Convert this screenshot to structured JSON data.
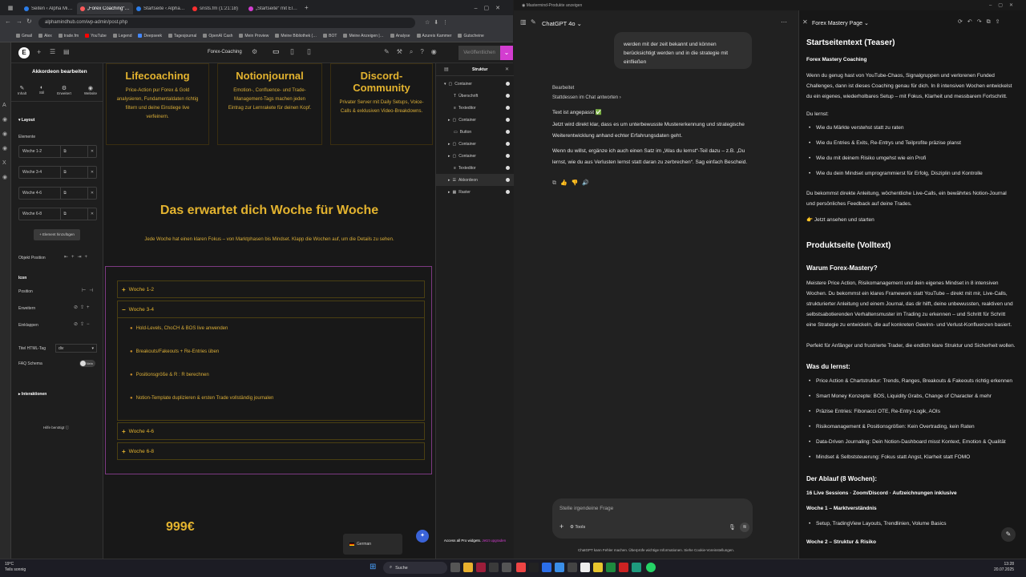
{
  "browser": {
    "tabs": [
      {
        "label": "Seiten ‹ Alpha Mind H…",
        "active": false
      },
      {
        "label": "„Forex Coaching“ mit El…",
        "active": true
      },
      {
        "label": "Startseite ‹ Alpha Mind H…",
        "active": false
      },
      {
        "label": "snsts.fm (1:21:18)",
        "active": false
      },
      {
        "label": "„Startseite“ mit Element…",
        "active": false
      }
    ],
    "url": "alphamindhub.com/wp-admin/post.php",
    "bookmarks": [
      "Gmail",
      "Alex",
      "trade.fm",
      "YouTube",
      "Legend",
      "Deepseek",
      "Tagesjournal",
      "OpenAI Cash",
      "Mein Proview",
      "Meine Bibliothek (…",
      "BOT",
      "Meine Anzeigen |…",
      "Analyse",
      "Azureis Kammer",
      "Gutscheine"
    ]
  },
  "editor": {
    "logo": "E",
    "page_selector": "Forex-Coaching",
    "publish_label": "Veröffentlichen",
    "left_panel": {
      "title": "Akkordeon bearbeiten",
      "tabs": [
        "Inhalt",
        "Stil",
        "Erweitert",
        "Website"
      ],
      "layout_section": "Layout",
      "elements_label": "Elemente",
      "items": [
        "Woche 1-2",
        "Woche 3-4",
        "Woche 4-6",
        "Woche 6-8"
      ],
      "add_button": "Element hinzufügen",
      "object_position": "Objekt Position",
      "icon_section": "Icon",
      "position_label": "Position",
      "expand_label": "Erweitern",
      "collapse_label": "Einklappen",
      "title_html_tag": "Titel HTML-Tag",
      "title_html_value": "div",
      "faq_schema": "FAQ Schema",
      "toggle_value": "Nein",
      "interactions": "Interaktionen",
      "help": "Hilfe benötigt"
    },
    "canvas": {
      "services": [
        {
          "title": "Lifecoaching",
          "text": "Price-Action pur Forex & Gold analysieren, Fundamentaldaten richtig filtern und deine Einstiege live verfeinern."
        },
        {
          "title": "Notionjournal",
          "text": "Emotion-, Confluence- und Trade-Management-Tags machen jeden Eintrag zur Lernrakete für deinen Kopf."
        },
        {
          "title": "Discord-Community",
          "text": "Privater Server mit Daily Setups, Voice-Calls & exklusiven Video-Breakdowns."
        }
      ],
      "heading": "Das erwartet dich Woche für Woche",
      "subheading": "Jede Woche hat einen klaren Fokus – von Marktphasen bis Mindset. Klapp die Wochen auf, um die Details zu sehen.",
      "accordion": [
        {
          "label": "Woche 1-2",
          "icon": "+"
        },
        {
          "label": "Woche 3-4",
          "icon": "−"
        },
        {
          "label": "Woche 4-6",
          "icon": "+"
        },
        {
          "label": "Woche 6-8",
          "icon": "+"
        }
      ],
      "open_items": [
        "Hold-Levels, ChoCH & BOS live anwenden",
        "Breakouts/Fakeouts + Re-Entries üben",
        "Positionsgröße & R : R berechnen",
        "Notion-Template duplizieren & ersten Trade vollständig journalen"
      ],
      "price": "999€",
      "language": "German"
    },
    "structure": {
      "title": "Struktur",
      "items": [
        "Container",
        "Überschrift",
        "Texteditor",
        "Container",
        "Button",
        "Container",
        "Container",
        "Texteditor",
        "Akkordeon",
        "Raster"
      ],
      "footer": "Access all Pro widgets.",
      "footer_link": "Jetzt upgraden"
    }
  },
  "chat": {
    "title": "Mastermind-Produkte anzeigen",
    "model": "ChatGPT 4o",
    "user_bubble": "werden mit der zeit bekannt und können berücksichtigt werden und in die strategie mit einfließen",
    "edited": "Bearbeitet",
    "reply_in_chat": "Stattdessen im Chat antworten ›",
    "adjusted": "Text ist angepasst ✅",
    "p1": "Jetzt wird direkt klar, dass es um unterbewusste Mustererkennung und strategische Weiterentwicklung anhand echter Erfahrungsdaten geht.",
    "p2": "Wenn du willst, ergänze ich auch einen Satz im „Was du lernst“-Teil dazu – z.B. „Du lernst, wie du aus Verlusten lernst statt daran zu zerbrechen“. Sag einfach Bescheid.",
    "prompt_placeholder": "Stelle irgendeine Frage",
    "tools_label": "Tools",
    "disclaimer": "ChatGPT kann Fehler machen. Überprüfe wichtige Informationen. Siehe Cookie-Voreinstellungen.",
    "canvas_title": "Forex Mastery Page",
    "doc": {
      "h1": "Startseitentext (Teaser)",
      "sub1": "Forex Mastery Coaching",
      "intro": "Wenn du genug hast von YouTube-Chaos, Signalgruppen und verlorenen Funded Challenges, dann ist dieses Coaching genau für dich. In 8 intensiven Wochen entwickelst du ein eigenes, wiederholbares Setup – mit Fokus, Klarheit und messbarem Fortschritt.",
      "learn_label": "Du lernst:",
      "learn": [
        "Wie du Märkte verstehst statt zu raten",
        "Wie du Entries & Exits, Re-Entrys und Teilprofite präzise planst",
        "Wie du mit deinem Risiko umgehst wie ein Profi",
        "Wie du dein Mindset umprogrammierst für Erfolg, Disziplin und Kontrolle"
      ],
      "direct": "Du bekommst direkte Anleitung, wöchentliche Live-Calls, ein bewährtes Notion-Journal und persönliches Feedback auf deine Trades.",
      "cta": "👉 Jetzt ansehen und starten",
      "h2": "Produktseite (Volltext)",
      "why": "Warum Forex-Mastery?",
      "why_text": "Meistere Price Action, Risikomanagement und dein eigenes Mindset in 8 intensiven Wochen. Du bekommst ein klares Framework statt YouTube – direkt mit mir, Live-Calls, strukturierter Anleitung und einem Journal, das dir hilft, deine unbewussten, reaktiven und selbstsabotierenden Verhaltensmuster im Trading zu erkennen – und Schritt für Schritt eine Strategie zu entwickeln, die auf konkreten Gewinn- und Verlust-Konfluenzen basiert.",
      "perfect": "Perfekt für Anfänger und frustrierte Trader, die endlich klare Struktur und Sicherheit wollen.",
      "what": "Was du lernst:",
      "what_list": [
        "Price Action & Chartstruktur: Trends, Ranges, Breakouts & Fakeouts richtig erkennen",
        "Smart Money Konzepte: BOS, Liquidity Grabs, Change of Character & mehr",
        "Präzise Entries: Fibonacci OTE, Re-Entry-Logik, AOIs",
        "Risikomanagement & Positionsgrößen: Kein Overtrading, kein Raten",
        "Data-Driven Journaling: Dein Notion-Dashboard misst Kontext, Emotion & Qualität",
        "Mindset & Selbststeuerung: Fokus statt Angst, Klarheit statt FOMO"
      ],
      "flow": "Der Ablauf (8 Wochen):",
      "sessions": "16 Live Sessions · Zoom/Discord · Aufzeichnungen inklusive",
      "week1": "Woche 1 – Marktverständnis",
      "week1_list": [
        "Setup, TradingView Layouts, Trendlinien, Volume Basics"
      ],
      "week2": "Woche 2 – Struktur & Risiko"
    }
  },
  "taskbar": {
    "weather_temp": "19°C",
    "weather_desc": "Teils sonnig",
    "search": "Suche",
    "time": "13:28",
    "date": "20.07.2025"
  }
}
